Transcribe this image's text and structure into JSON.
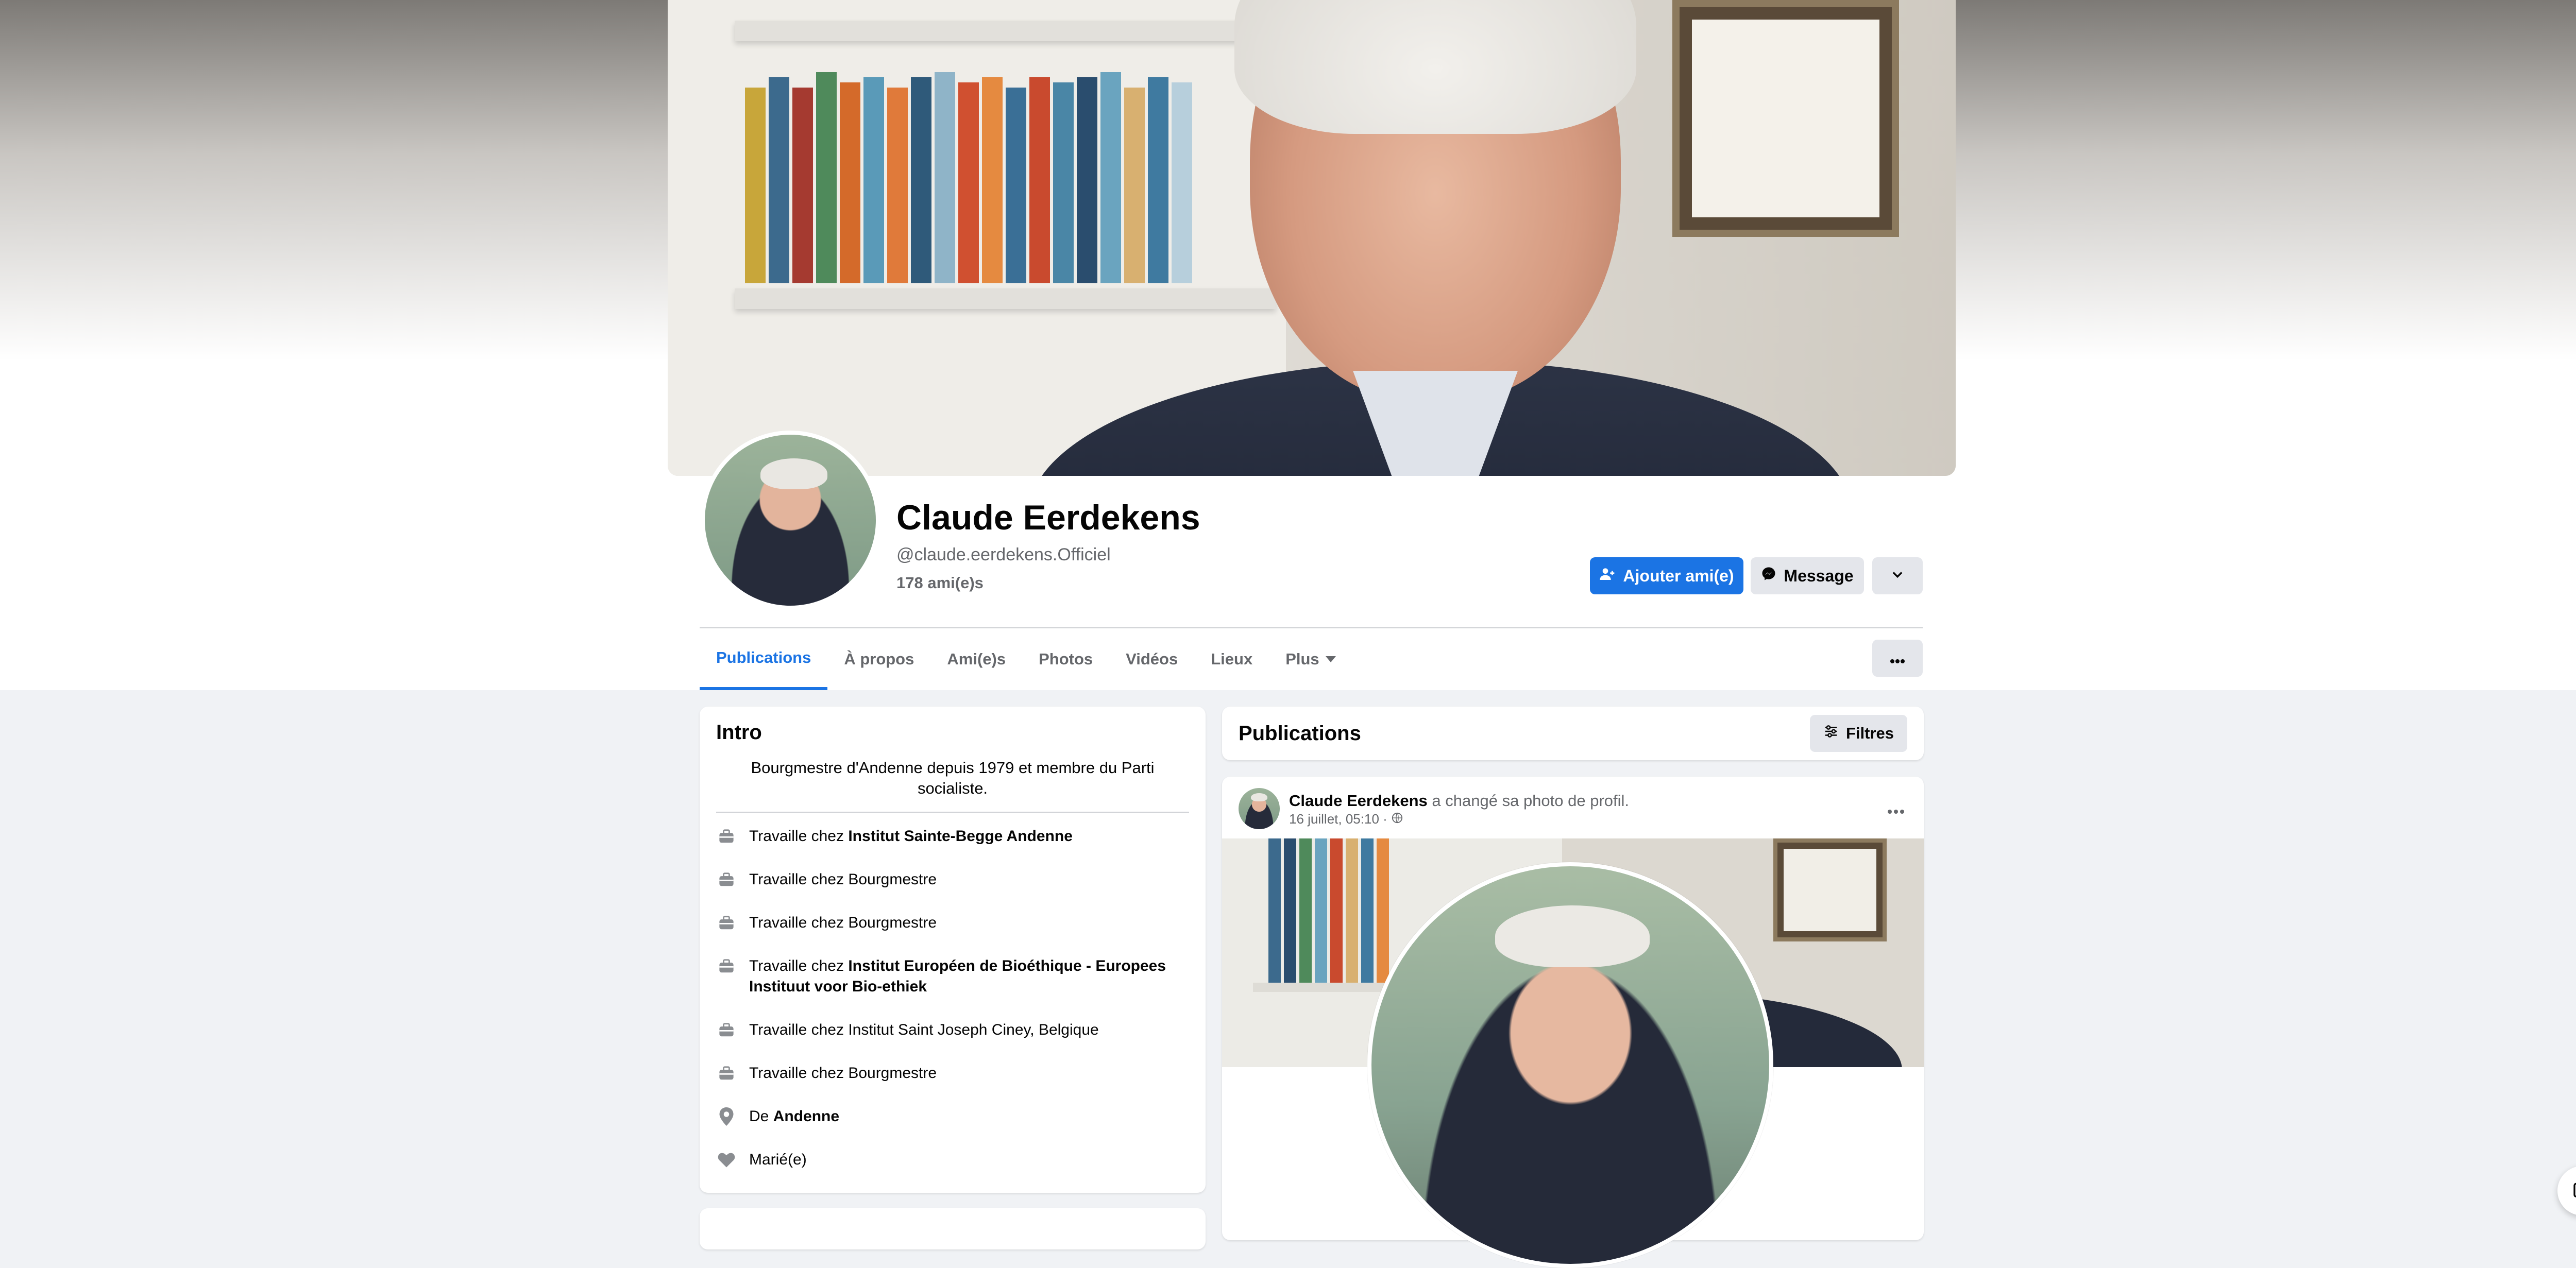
{
  "profile": {
    "name": "Claude Eerdekens",
    "handle": "@claude.eerdekens.Officiel",
    "friends": "178 ami(e)s"
  },
  "actions": {
    "add_friend": "Ajouter ami(e)",
    "message": "Message"
  },
  "tabs": [
    {
      "label": "Publications"
    },
    {
      "label": "À propos"
    },
    {
      "label": "Ami(e)s"
    },
    {
      "label": "Photos"
    },
    {
      "label": "Vidéos"
    },
    {
      "label": "Lieux"
    },
    {
      "label": "Plus"
    }
  ],
  "intro": {
    "title": "Intro",
    "bio": "Bourgmestre d'Andenne depuis 1979 et membre du Parti socialiste.",
    "items": [
      {
        "prefix": "Travaille chez",
        "value": "Institut Sainte-Begge Andenne",
        "bold": true,
        "icon": "briefcase-icon"
      },
      {
        "prefix": "Travaille chez",
        "value": "Bourgmestre",
        "bold": false,
        "icon": "briefcase-icon"
      },
      {
        "prefix": "Travaille chez",
        "value": "Bourgmestre",
        "bold": false,
        "icon": "briefcase-icon"
      },
      {
        "prefix": "Travaille chez",
        "value": "Institut Européen de Bioéthique - Europees Instituut voor Bio-ethiek",
        "bold": true,
        "icon": "briefcase-icon"
      },
      {
        "prefix": "Travaille chez",
        "value": "Institut Saint Joseph Ciney, Belgique",
        "bold": false,
        "icon": "briefcase-icon"
      },
      {
        "prefix": "Travaille chez",
        "value": "Bourgmestre",
        "bold": false,
        "icon": "briefcase-icon"
      },
      {
        "prefix": "De",
        "value": "Andenne",
        "bold": true,
        "icon": "location-pin-icon"
      },
      {
        "prefix": "",
        "value": "Marié(e)",
        "bold": false,
        "icon": "heart-icon"
      }
    ]
  },
  "publications": {
    "title": "Publications",
    "filter_label": "Filtres"
  },
  "post": {
    "author": "Claude Eerdekens",
    "action": "a changé sa photo de profil.",
    "meta": "16 juillet, 05:10 ·"
  },
  "colors": {
    "accent": "#1b74e4",
    "secondary_button": "#e4e6eb",
    "page_background": "#f0f2f5",
    "muted_text": "#65676b"
  }
}
